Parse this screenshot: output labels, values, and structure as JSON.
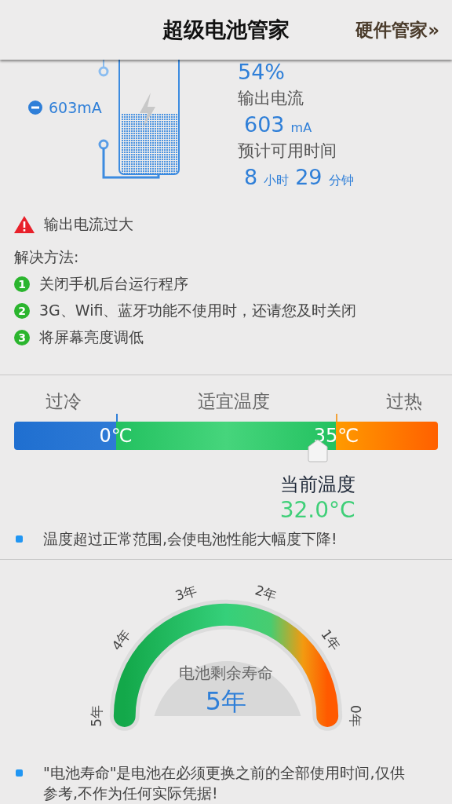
{
  "header": {
    "title": "超级电池管家",
    "link": "硬件管家»"
  },
  "battery": {
    "current_badge": "603mA",
    "percent": "54%",
    "output_label": "输出电流",
    "output_value": "603",
    "output_unit": "mA",
    "time_label": "预计可用时间",
    "hours": "8",
    "hours_unit": "小时",
    "minutes": "29",
    "minutes_unit": "分钟"
  },
  "warning": "输出电流过大",
  "solution_title": "解决方法:",
  "solutions": [
    {
      "number": "1",
      "text": "关闭手机后台运行程序"
    },
    {
      "number": "2",
      "text": "3G、Wifi、蓝牙功能不使用时，还请您及时关闭"
    },
    {
      "number": "3",
      "text": "将屏幕亮度调低"
    }
  ],
  "temperature": {
    "zones": [
      "过冷",
      "适宜温度",
      "过热"
    ],
    "low_tick": "0℃",
    "high_tick": "35℃",
    "current_label": "当前温度",
    "current_value": "32.0°C",
    "note": "温度超过正常范围,会使电池性能大幅度下降!"
  },
  "life": {
    "scale": [
      "5年",
      "4年",
      "3年",
      "2年",
      "1年",
      "0年"
    ],
    "label": "电池剩余寿命",
    "value": "5年",
    "note": "\"电池寿命\"是电池在必须更换之前的全部使用时间,仅供参考,不作为任何实际凭据!"
  }
}
